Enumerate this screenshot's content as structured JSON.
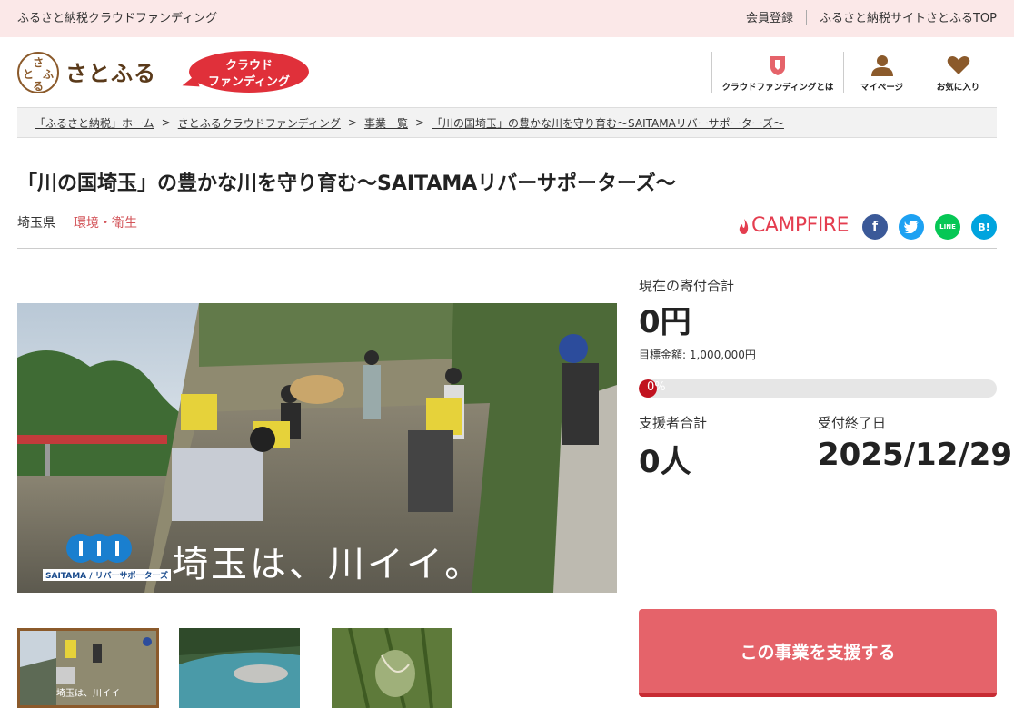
{
  "topbar": {
    "site_name": "ふるさと納税クラウドファンディング",
    "register": "会員登録",
    "top_link": "ふるさと納税サイトさとふるTOP"
  },
  "header": {
    "logo_text": "さとふる",
    "logo_mark": [
      "さ",
      "と",
      "ふ",
      "る"
    ],
    "badge_line1": "クラウド",
    "badge_line2": "ファンディング",
    "nav": [
      {
        "label": "クラウドファンディングとは",
        "icon": "shield-icon"
      },
      {
        "label": "マイページ",
        "icon": "user-icon"
      },
      {
        "label": "お気に入り",
        "icon": "heart-icon"
      }
    ]
  },
  "breadcrumb": [
    "「ふるさと納税」ホーム",
    "さとふるクラウドファンディング",
    "事業一覧",
    "「川の国埼玉」の豊かな川を守り育む～SAITAMAリバーサポーターズ～"
  ],
  "breadcrumb_sep": ">",
  "project": {
    "title": "「川の国埼玉」の豊かな川を守り育む～SAITAMAリバーサポーターズ～",
    "prefecture": "埼玉県",
    "category": "環境・衛生",
    "platform": "CAMPFIRE",
    "image_caption": "埼玉は、川イイ。",
    "image_logo": "SAITAMA / リバーサポーターズ"
  },
  "share": {
    "facebook": "f",
    "twitter": "t",
    "line": "LINE",
    "hatena": "B!"
  },
  "stats": {
    "current_total_label": "現在の寄付合計",
    "current_total": "0円",
    "goal_text": "目標金額: 1,000,000円",
    "progress_label": "0%",
    "progress_fraction": 0.0,
    "supporters_label": "支援者合計",
    "supporters": "0人",
    "deadline_label": "受付終了日",
    "deadline": "2025/12/29"
  },
  "cta": {
    "label": "この事業を支援する"
  },
  "colors": {
    "accent": "#e5636a",
    "brand_red": "#e0303a",
    "topbar_bg": "#fbe8e8",
    "category": "#d3555a"
  }
}
